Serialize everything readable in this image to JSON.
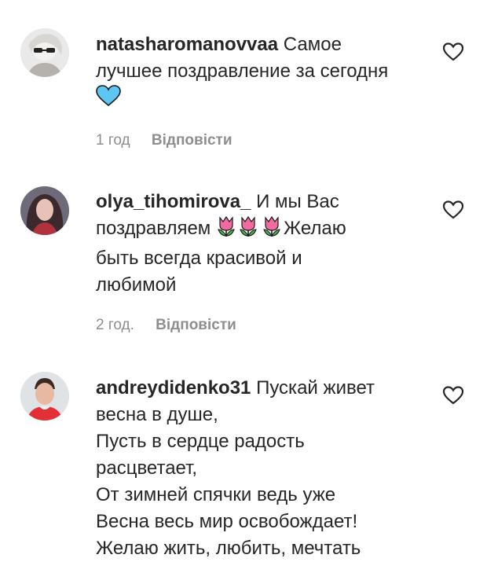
{
  "comments": [
    {
      "username": "natasharomanovvaa",
      "text_parts": [
        "Самое",
        "лучшее поздравление за сегодня"
      ],
      "emoji": [
        "blue-heart"
      ],
      "time": "1 год",
      "reply_label": "Відповісти"
    },
    {
      "username": "olya_tihomirova_",
      "text_parts": [
        "И мы Вас",
        "поздравляем",
        "Желаю",
        "быть всегда красивой и",
        "любимой"
      ],
      "emoji": [
        "tulip",
        "tulip",
        "tulip"
      ],
      "time": "2 год.",
      "reply_label": "Відповісти"
    },
    {
      "username": "andreydidenko31",
      "text_parts": [
        "Пускай живет",
        "весна в душе,",
        "Пусть в сердце радость",
        "расцветает,",
        "От зимней спячки ведь уже",
        "Весна весь мир освобождает!",
        "Желаю жить, любить, мечтать"
      ]
    }
  ],
  "colors": {
    "heart_emoji": "#5ec6f2",
    "tulip_pink": "#f06b9f",
    "tulip_green": "#4caf50",
    "meta_gray": "#8e8e8e"
  }
}
